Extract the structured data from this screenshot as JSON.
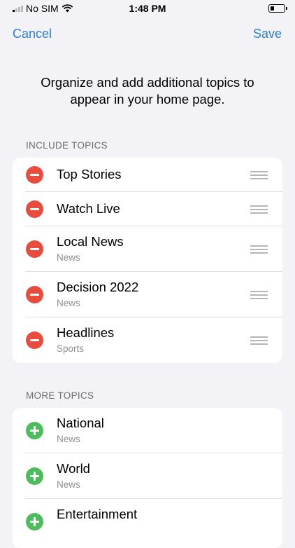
{
  "status_bar": {
    "carrier": "No SIM",
    "time": "1:48 PM"
  },
  "nav": {
    "cancel_label": "Cancel",
    "save_label": "Save"
  },
  "intro_text": "Organize and add additional topics to appear in your home page.",
  "include_section": {
    "header": "INCLUDE TOPICS",
    "items": [
      {
        "title": "Top Stories",
        "subtitle": ""
      },
      {
        "title": "Watch Live",
        "subtitle": ""
      },
      {
        "title": "Local News",
        "subtitle": "News"
      },
      {
        "title": "Decision 2022",
        "subtitle": "News"
      },
      {
        "title": "Headlines",
        "subtitle": "Sports"
      }
    ]
  },
  "more_section": {
    "header": "MORE TOPICS",
    "items": [
      {
        "title": "National",
        "subtitle": "News"
      },
      {
        "title": "World",
        "subtitle": "News"
      },
      {
        "title": "Entertainment",
        "subtitle": ""
      }
    ]
  },
  "colors": {
    "accent": "#2f7dd7",
    "remove": "#e94b3c",
    "add": "#4cbd5a",
    "background": "#f2f2f7"
  }
}
